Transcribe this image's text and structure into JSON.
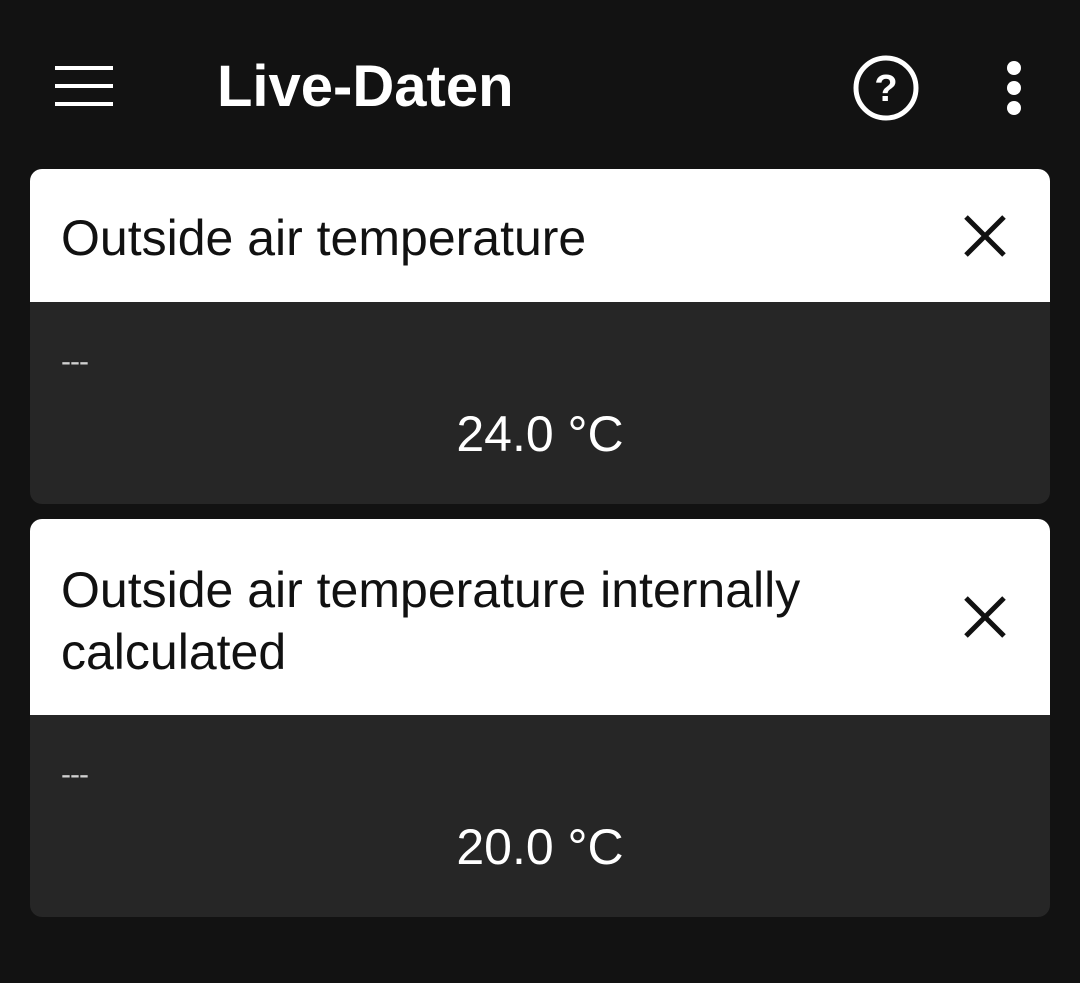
{
  "appbar": {
    "title": "Live-Daten",
    "menu_icon": "hamburger-menu-icon",
    "help_icon": "help-circle-icon",
    "more_icon": "more-vert-icon"
  },
  "cards": [
    {
      "title": "Outside air temperature",
      "label": "---",
      "value": "24.0 °C",
      "close_icon": "close-icon"
    },
    {
      "title": "Outside air temperature internally calculated",
      "label": "---",
      "value": "20.0 °C",
      "close_icon": "close-icon"
    }
  ],
  "colors": {
    "background": "#121212",
    "card_header": "#ffffff",
    "card_body": "#262626",
    "text_light": "#ffffff",
    "text_dark": "#111111"
  }
}
